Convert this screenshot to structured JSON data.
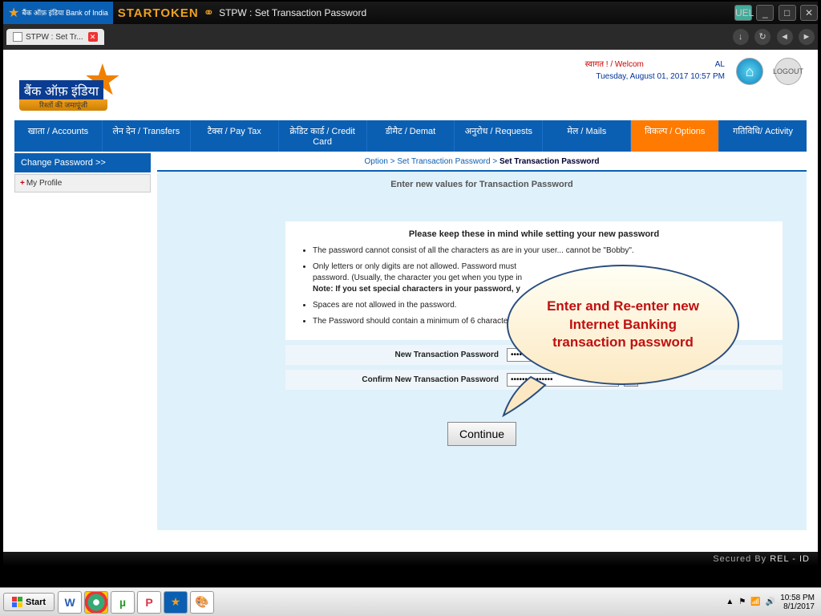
{
  "titlebar": {
    "boi_text": "बैंक ऑफ़ इंडिया\nBank of India",
    "brand": "STARTOKEN",
    "title": "STPW : Set Transaction Password",
    "uel_label": "UEL"
  },
  "tabbar": {
    "tab_label": "STPW : Set Tr..."
  },
  "header": {
    "bank_name": "बैंक ऑफ़ इंडिया",
    "tagline": "रिश्तों की जमापूंजी",
    "welcome_prefix": "स्वागत ! / Welcom",
    "welcome_suffix": "AL",
    "datetime": "Tuesday, August 01, 2017 10:57 PM",
    "logout": "LOGOUT"
  },
  "nav": {
    "accounts": "खाता / Accounts",
    "transfers": "लेन देन / Transfers",
    "paytax": "टैक्स / Pay Tax",
    "creditcard": "क्रेडिट कार्ड / Credit Card",
    "demat": "डीमैट / Demat",
    "requests": "अनुरोध / Requests",
    "mails": "मेल / Mails",
    "options": "विकल्प / Options",
    "activity": "गतिविधि/ Activity"
  },
  "sidebar": {
    "change_password": "Change Password >>",
    "my_profile": "My Profile"
  },
  "breadcrumb": {
    "part1": "Option",
    "part2": "Set Transaction Password",
    "current": "Set Transaction Password"
  },
  "content": {
    "instruction": "Enter new values for Transaction Password",
    "rules_title": "Please keep these in mind while setting your new password",
    "rule1": "The password cannot consist of all the characters as are in your user... cannot be \"Bobby\".",
    "rule2a": "Only letters or only digits are not allowed. Password must",
    "rule2b": "password. (Usually, the character you get when you type in",
    "rule_note": "Note: If you set special characters in your password, y",
    "rule3": "Spaces are not allowed in the password.",
    "rule4": "The Password should contain a minimum of 6 characters and a maximum of 28 charac",
    "label_new": "New Transaction Password",
    "label_confirm": "Confirm New Transaction Password",
    "pw_value": "•••••••••••••••",
    "continue": "Continue"
  },
  "callout": {
    "text": "Enter and Re-enter new Internet Banking transaction password"
  },
  "footer": {
    "secured_by": "Secured By",
    "relid": "REL - ID"
  },
  "taskbar": {
    "start": "Start",
    "word": "W",
    "ut": "µ",
    "ppt": "P",
    "boi": "★",
    "paint": "🎨",
    "time": "10:58 PM",
    "date": "8/1/2017"
  }
}
